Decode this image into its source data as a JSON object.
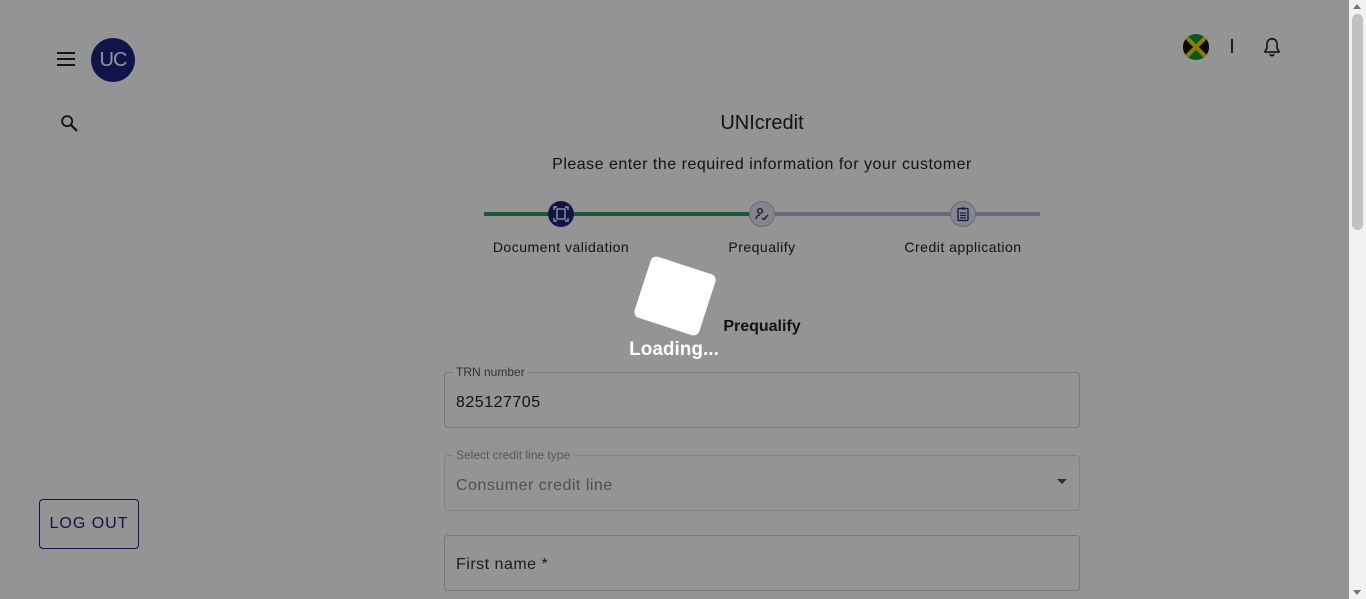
{
  "header": {
    "avatar_initials": "UC",
    "flag_name": "jamaica-flag",
    "divider_text": ""
  },
  "main": {
    "app_title": "UNIcredit",
    "subtitle": "Please enter the required information for your customer",
    "section_title": "Prequalify"
  },
  "stepper": {
    "steps": [
      {
        "label": "Document validation",
        "icon": "document-scan-icon",
        "status": "active"
      },
      {
        "label": "Prequalify",
        "icon": "signature-icon",
        "status": "current"
      },
      {
        "label": "Credit application",
        "icon": "clipboard-icon",
        "status": "pending"
      }
    ],
    "colors": {
      "done": "#2e9a5e",
      "pending": "#b9b4d6",
      "active_node": "#1a237e",
      "pending_node": "#e6e6f0"
    }
  },
  "form": {
    "trn": {
      "label": "TRN number",
      "value": "825127705"
    },
    "credit_line": {
      "label": "Select credit line type",
      "value": "Consumer credit line"
    },
    "first_name": {
      "placeholder": "First name *"
    }
  },
  "sidebar": {
    "logout_label": "LOG OUT"
  },
  "overlay": {
    "loading_text": "Loading..."
  }
}
